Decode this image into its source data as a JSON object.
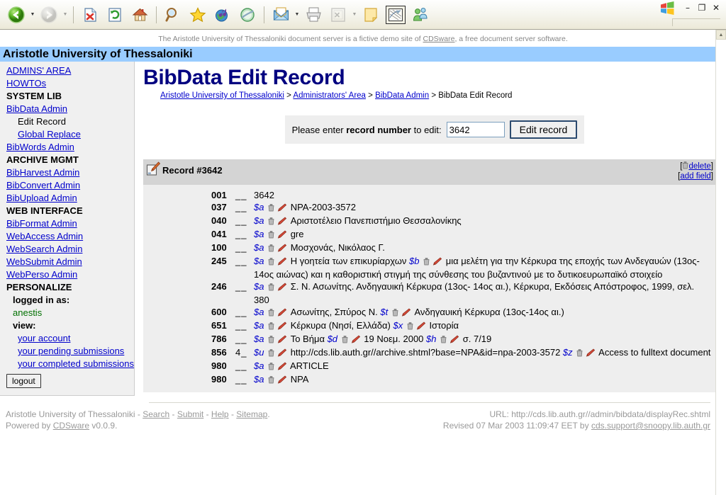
{
  "browser": {
    "toolbar_buttons": [
      {
        "name": "back-button",
        "icon": "back-arrow-icon",
        "state": "enabled"
      },
      {
        "name": "back-dropdown",
        "icon": "chevron-down-icon",
        "state": "enabled"
      },
      {
        "name": "forward-button",
        "icon": "forward-arrow-icon",
        "state": "disabled"
      },
      {
        "name": "forward-dropdown",
        "icon": "chevron-down-icon",
        "state": "disabled"
      },
      {
        "name": "stop-button",
        "icon": "stop-icon",
        "state": "enabled"
      },
      {
        "name": "refresh-button",
        "icon": "refresh-icon",
        "state": "enabled"
      },
      {
        "name": "home-button",
        "icon": "home-icon",
        "state": "enabled"
      },
      {
        "name": "search-button",
        "icon": "search-icon",
        "state": "enabled"
      },
      {
        "name": "favorites-button",
        "icon": "star-icon",
        "state": "enabled"
      },
      {
        "name": "media-button",
        "icon": "globe-note-icon",
        "state": "enabled"
      },
      {
        "name": "history-button",
        "icon": "history-icon",
        "state": "enabled"
      },
      {
        "name": "mail-button",
        "icon": "mail-icon",
        "state": "enabled"
      },
      {
        "name": "print-button",
        "icon": "printer-icon",
        "state": "enabled"
      },
      {
        "name": "edit-button",
        "icon": "edit-page-icon",
        "state": "disabled"
      },
      {
        "name": "notes-button",
        "icon": "note-icon",
        "state": "enabled"
      },
      {
        "name": "discuss-button",
        "icon": "discuss-icon",
        "state": "enabled"
      },
      {
        "name": "messenger-button",
        "icon": "messenger-people-icon",
        "state": "enabled"
      }
    ],
    "window_controls": {
      "logo": "windows-logo-icon",
      "minimize": "–",
      "restore": "❐",
      "close": "✕"
    },
    "scrollbar_up_arrow": "▲"
  },
  "notice": {
    "before": "The Aristotle University of Thessaloniki document server is a fictive demo site of ",
    "link": "CDSware",
    "after": ", a free document server software."
  },
  "site_title": "Aristotle University of Thessaloniki",
  "sidebar": {
    "items": [
      {
        "label": "ADMINS' AREA",
        "type": "link",
        "name": "sidebar-item-admins-area"
      },
      {
        "label": "HOWTOs",
        "type": "link",
        "name": "sidebar-item-howtos"
      },
      {
        "label": "SYSTEM LIB",
        "type": "head",
        "name": "sidebar-heading-system-lib"
      },
      {
        "label": "BibData Admin",
        "type": "link",
        "name": "sidebar-item-bibdata-admin"
      },
      {
        "label": "Edit Record",
        "type": "plain",
        "name": "sidebar-item-edit-record"
      },
      {
        "label": "Global Replace",
        "type": "sublink",
        "name": "sidebar-item-global-replace"
      },
      {
        "label": "BibWords Admin",
        "type": "link",
        "name": "sidebar-item-bibwords-admin"
      },
      {
        "label": "ARCHIVE MGMT",
        "type": "head",
        "name": "sidebar-heading-archive-mgmt"
      },
      {
        "label": "BibHarvest Admin",
        "type": "link",
        "name": "sidebar-item-bibharvest-admin"
      },
      {
        "label": "BibConvert Admin",
        "type": "link",
        "name": "sidebar-item-bibconvert-admin"
      },
      {
        "label": "BibUpload Admin",
        "type": "link",
        "name": "sidebar-item-bibupload-admin"
      },
      {
        "label": "WEB INTERFACE",
        "type": "head",
        "name": "sidebar-heading-web-interface"
      },
      {
        "label": "BibFormat Admin",
        "type": "link",
        "name": "sidebar-item-bibformat-admin"
      },
      {
        "label": "WebAccess Admin",
        "type": "link",
        "name": "sidebar-item-webaccess-admin"
      },
      {
        "label": "WebSearch Admin",
        "type": "link",
        "name": "sidebar-item-websearch-admin"
      },
      {
        "label": "WebSubmit Admin",
        "type": "link",
        "name": "sidebar-item-websubmit-admin"
      },
      {
        "label": "WebPerso Admin",
        "type": "link",
        "name": "sidebar-item-webperso-admin"
      },
      {
        "label": "PERSONALIZE",
        "type": "head",
        "name": "sidebar-heading-personalize"
      },
      {
        "label": "logged in as:",
        "type": "sublabel",
        "name": "sidebar-logged-in-label"
      },
      {
        "label": "anestis",
        "type": "user",
        "name": "sidebar-username"
      },
      {
        "label": "view:",
        "type": "sublabel",
        "name": "sidebar-view-label"
      },
      {
        "label": "your account",
        "type": "sublink",
        "name": "sidebar-item-your-account"
      },
      {
        "label": "your pending submissions",
        "type": "sublink",
        "name": "sidebar-item-pending-submissions"
      },
      {
        "label": "your completed submissions",
        "type": "sublink",
        "name": "sidebar-item-completed-submissions"
      }
    ],
    "logout_label": "logout"
  },
  "main": {
    "page_title": "BibData Edit Record",
    "breadcrumb": [
      {
        "label": "Aristotle University of Thessaloniki",
        "link": true
      },
      {
        "label": "Administrators' Area",
        "link": true
      },
      {
        "label": "BibData Admin",
        "link": true
      },
      {
        "label": "BibData Edit Record",
        "link": false
      }
    ],
    "breadcrumb_separator": ">",
    "search": {
      "label_before": "Please enter ",
      "label_bold": "record number",
      "label_after": " to edit:",
      "value": "3642",
      "placeholder": "",
      "button_label": "Edit record"
    },
    "record": {
      "heading": "Record #3642",
      "heading_icon": "edit-record-icon",
      "delete_label": "delete",
      "delete_icon": "trash-icon",
      "add_field_label": "add field",
      "bracket_open": "[",
      "bracket_close": "]",
      "fields": [
        {
          "tag": "001",
          "ind": "__",
          "parts": [
            {
              "type": "text",
              "value": "3642"
            }
          ]
        },
        {
          "tag": "037",
          "ind": "__",
          "parts": [
            {
              "type": "sub",
              "value": "$a"
            },
            {
              "type": "icons"
            },
            {
              "type": "text",
              "value": "NPA-2003-3572"
            }
          ]
        },
        {
          "tag": "040",
          "ind": "__",
          "parts": [
            {
              "type": "sub",
              "value": "$a"
            },
            {
              "type": "icons"
            },
            {
              "type": "text",
              "value": "Αριστοτέλειο Πανεπιστήμιο Θεσσαλονίκης"
            }
          ]
        },
        {
          "tag": "041",
          "ind": "__",
          "parts": [
            {
              "type": "sub",
              "value": "$a"
            },
            {
              "type": "icons"
            },
            {
              "type": "text",
              "value": "gre"
            }
          ]
        },
        {
          "tag": "100",
          "ind": "__",
          "parts": [
            {
              "type": "sub",
              "value": "$a"
            },
            {
              "type": "icons"
            },
            {
              "type": "text",
              "value": "Μοσχονάς, Νικόλαος Γ."
            }
          ]
        },
        {
          "tag": "245",
          "ind": "__",
          "parts": [
            {
              "type": "sub",
              "value": "$a"
            },
            {
              "type": "icons"
            },
            {
              "type": "text",
              "value": "Η γοητεία των επικυρίαρχων "
            },
            {
              "type": "sub",
              "value": "$b"
            },
            {
              "type": "icons"
            },
            {
              "type": "text",
              "value": "μια μελέτη για την Κέρκυρα της εποχής των Ανδεγαυών (13ος- 14ος αιώνας) και η καθοριστική στιγμή της σύνθεσης του βυζαντινού με το δυτικοευρωπαϊκό στοιχείο"
            }
          ]
        },
        {
          "tag": "246",
          "ind": "__",
          "parts": [
            {
              "type": "sub",
              "value": "$a"
            },
            {
              "type": "icons"
            },
            {
              "type": "text",
              "value": "Σ. Ν. Ασωνίτης. Ανδηγαυική Κέρκυρα (13ος- 14ος αι.), Κέρκυρα, Εκδόσεις Απόστροφος, 1999, σελ. 380"
            }
          ]
        },
        {
          "tag": "600",
          "ind": "__",
          "parts": [
            {
              "type": "sub",
              "value": "$a"
            },
            {
              "type": "icons"
            },
            {
              "type": "text",
              "value": "Ασωνίτης, Σπύρος Ν. "
            },
            {
              "type": "sub",
              "value": "$t"
            },
            {
              "type": "icons"
            },
            {
              "type": "text",
              "value": "Ανδηγαυική Κέρκυρα (13ος-14ος αι.)"
            }
          ]
        },
        {
          "tag": "651",
          "ind": "__",
          "parts": [
            {
              "type": "sub",
              "value": "$a"
            },
            {
              "type": "icons"
            },
            {
              "type": "text",
              "value": "Κέρκυρα (Νησί, Ελλάδα) "
            },
            {
              "type": "sub",
              "value": "$x"
            },
            {
              "type": "icons"
            },
            {
              "type": "text",
              "value": "Ιστορία"
            }
          ]
        },
        {
          "tag": "786",
          "ind": "__",
          "parts": [
            {
              "type": "sub",
              "value": "$a"
            },
            {
              "type": "icons"
            },
            {
              "type": "text",
              "value": "Το Βήμα "
            },
            {
              "type": "sub",
              "value": "$d"
            },
            {
              "type": "icons"
            },
            {
              "type": "text",
              "value": "19 Νοεμ. 2000 "
            },
            {
              "type": "sub",
              "value": "$h"
            },
            {
              "type": "icons"
            },
            {
              "type": "text",
              "value": "σ. 7/19"
            }
          ]
        },
        {
          "tag": "856",
          "ind": "4_",
          "parts": [
            {
              "type": "sub",
              "value": "$u"
            },
            {
              "type": "icons"
            },
            {
              "type": "text",
              "value": "http://cds.lib.auth.gr//archive.shtml?base=NPA&id=npa-2003-3572 "
            },
            {
              "type": "sub",
              "value": "$z"
            },
            {
              "type": "icons"
            },
            {
              "type": "text",
              "value": "Access to fulltext document"
            }
          ]
        },
        {
          "tag": "980",
          "ind": "__",
          "parts": [
            {
              "type": "sub",
              "value": "$a"
            },
            {
              "type": "icons"
            },
            {
              "type": "text",
              "value": "ARTICLE"
            }
          ]
        },
        {
          "tag": "980",
          "ind": "__",
          "parts": [
            {
              "type": "sub",
              "value": "$a"
            },
            {
              "type": "icons"
            },
            {
              "type": "text",
              "value": "NPA"
            }
          ]
        }
      ]
    }
  },
  "footer": {
    "left_line1_prefix": "Aristotle University of Thessaloniki - ",
    "left_links": [
      "Search",
      "Submit",
      "Help",
      "Sitemap"
    ],
    "left_link_sep": " - ",
    "left_line1_suffix": ".",
    "left_line2_prefix": "Powered by ",
    "left_line2_link": "CDSware",
    "left_line2_suffix": " v0.0.9.",
    "right_line1": "URL: http://cds.lib.auth.gr//admin/bibdata/displayRec.shtml",
    "right_line2_prefix": "Revised 07 Mar 2003 11:09:47 EET by ",
    "right_line2_link": "cds.support@snoopy.lib.auth.gr"
  },
  "colors": {
    "title_bar": "#99ccff",
    "heading": "#000080",
    "link": "#0000cc",
    "user_green": "#007000",
    "subfield": "#0000cc",
    "record_head_bg": "#d4d4d4",
    "record_body_bg": "#eeeeee",
    "sidebar_bg": "#f0f0f0",
    "footer_text": "#999999"
  }
}
